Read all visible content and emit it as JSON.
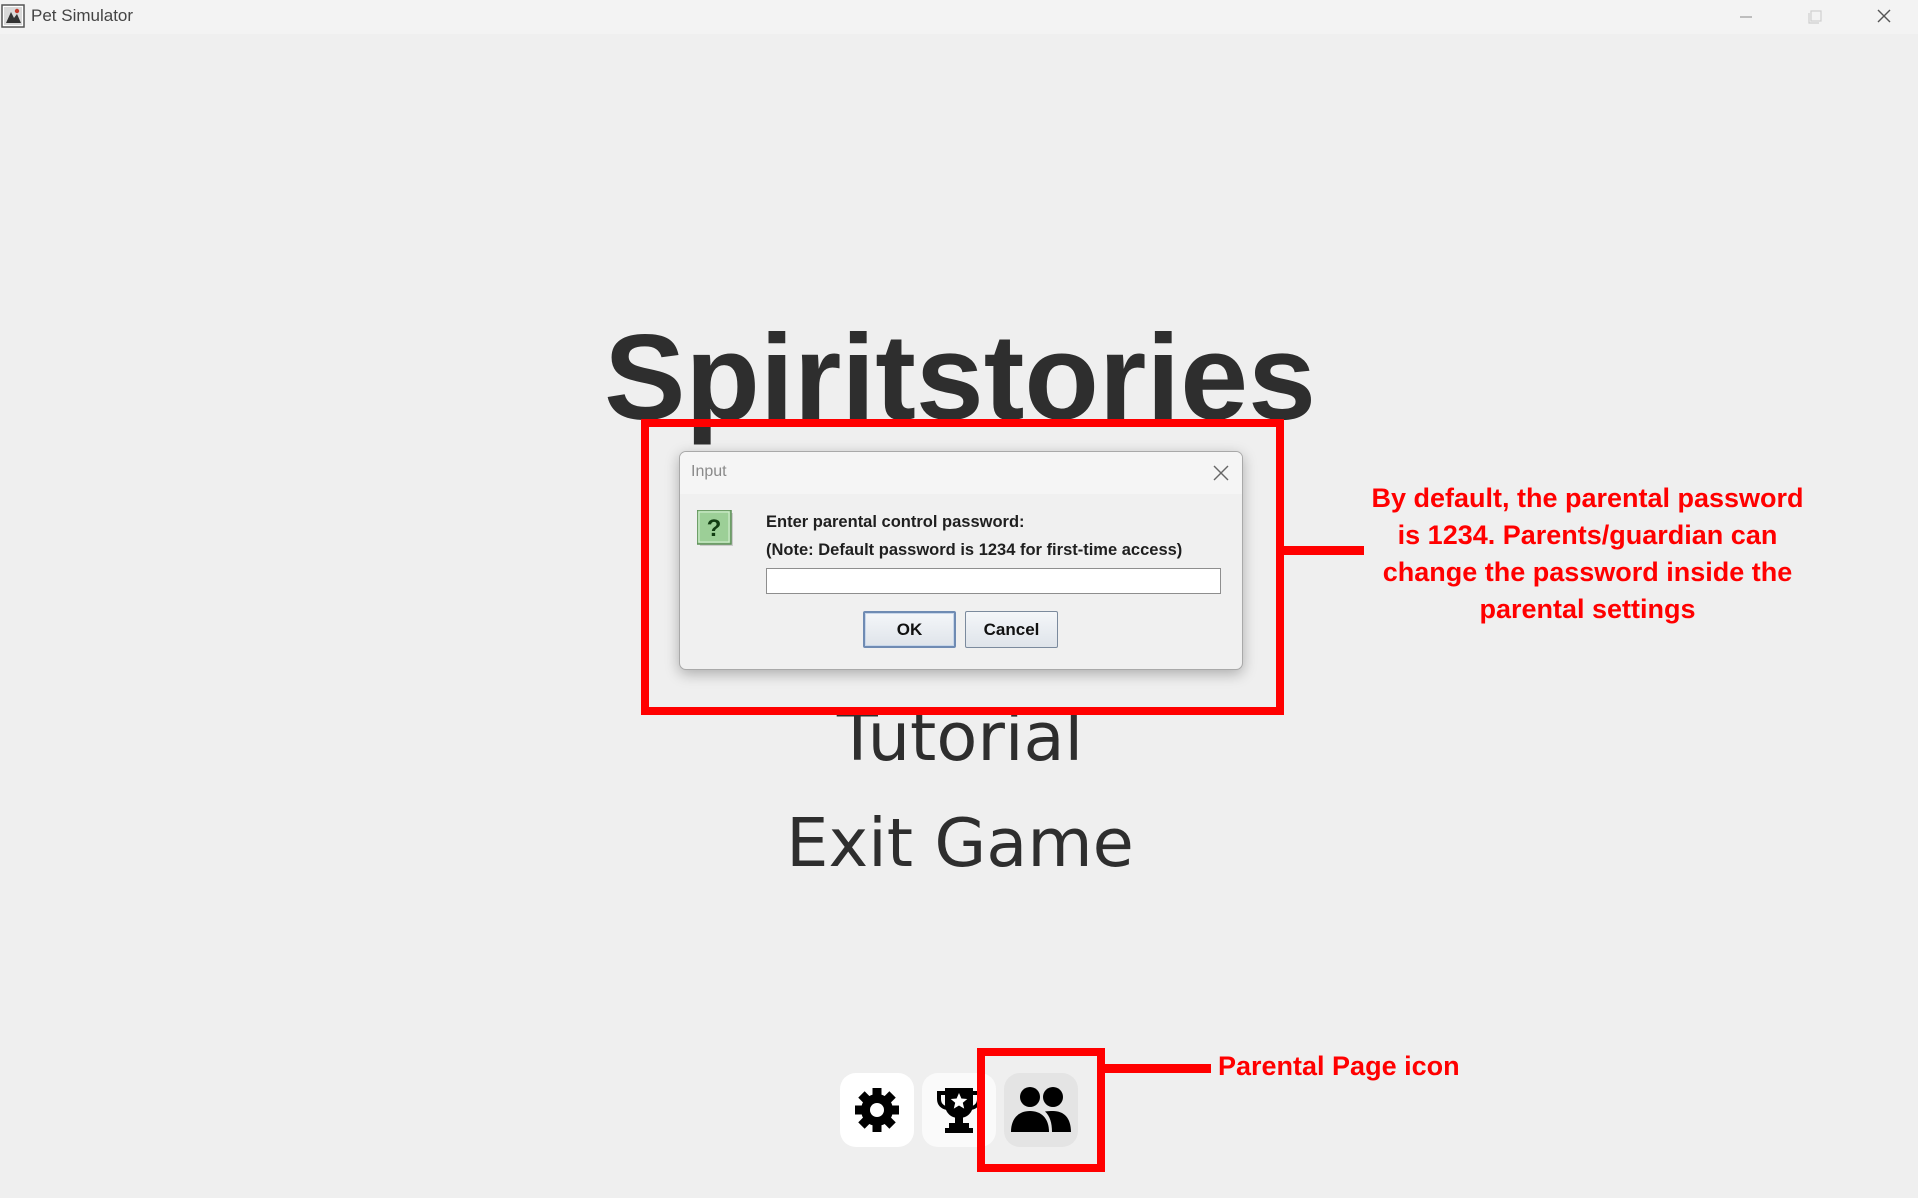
{
  "window": {
    "title": "Pet Simulator",
    "icon": "app-icon",
    "controls": [
      "minimize-icon",
      "maximize-icon",
      "close-icon"
    ]
  },
  "menu": {
    "title": "Spiritstories",
    "items": [
      {
        "label": "Tutorial"
      },
      {
        "label": "Exit Game"
      }
    ]
  },
  "bottom_icons": [
    {
      "name": "gear-icon"
    },
    {
      "name": "trophy-icon"
    },
    {
      "name": "users-icon"
    }
  ],
  "dialog": {
    "title": "Input",
    "icon": "question-icon",
    "icon_glyph": "?",
    "prompt_line1": "Enter parental control password:",
    "prompt_line2": "(Note: Default password is 1234 for first-time access)",
    "input_value": "",
    "ok_label": "OK",
    "cancel_label": "Cancel"
  },
  "annotations": {
    "color": "#ff0000",
    "dialog_note": "By default, the parental password is 1234. Parents/guardian can change the password inside the parental settings",
    "icon_note": "Parental Page icon"
  }
}
